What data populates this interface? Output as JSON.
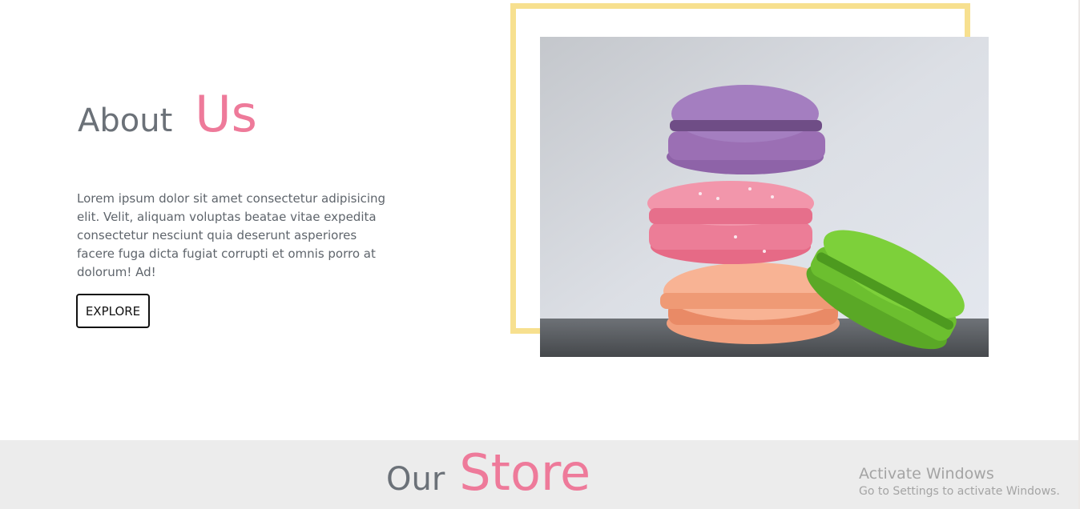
{
  "about": {
    "title_word1": "About",
    "title_word2": "Us",
    "body": "Lorem ipsum dolor sit amet consectetur adipisicing elit. Velit, aliquam voluptas beatae vitae expedita consectetur nesciunt quia deserunt asperiores facere fuga dicta fugiat corrupti et omnis porro at dolorum! Ad!",
    "button_label": "EXPLORE"
  },
  "image": {
    "subject": "stack of macarons"
  },
  "store": {
    "title_word1": "Our",
    "title_word2": "Store"
  },
  "watermark": {
    "line1": "Activate Windows",
    "line2": "Go to Settings to activate Windows."
  },
  "colors": {
    "accent_pink": "#ee7a9a",
    "heading_gray": "#6b7178",
    "frame_yellow": "#f7e08f",
    "band_gray": "#ececec"
  }
}
